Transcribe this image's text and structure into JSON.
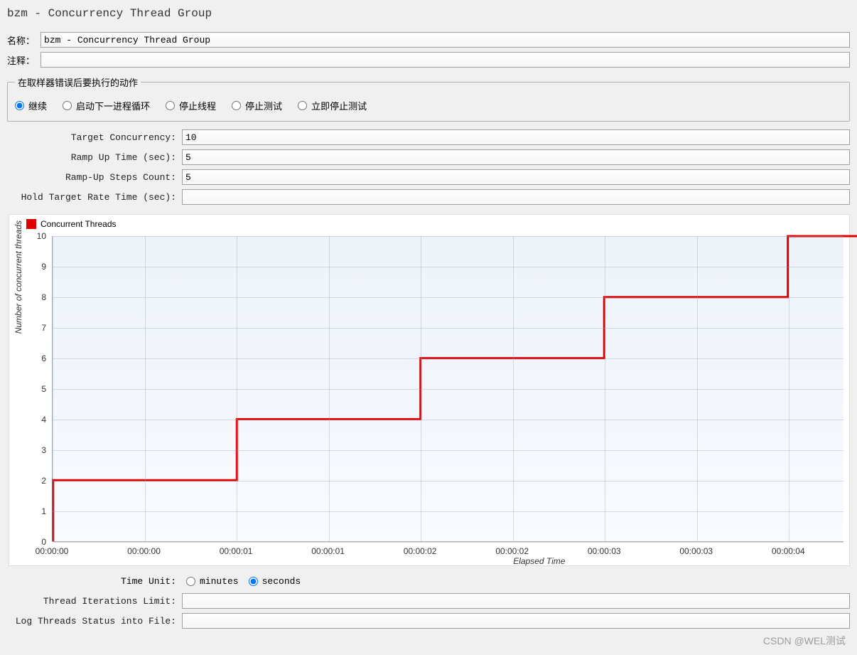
{
  "title": "bzm - Concurrency Thread Group",
  "labels": {
    "name": "名称：",
    "comment": "注释：",
    "error_action_group": "在取样器错误后要执行的动作"
  },
  "fields": {
    "name_value": "bzm - Concurrency Thread Group",
    "comment_value": "",
    "target_concurrency_label": "Target Concurrency:",
    "target_concurrency_value": "10",
    "ramp_up_time_label": "Ramp Up Time (sec):",
    "ramp_up_time_value": "5",
    "ramp_up_steps_label": "Ramp-Up Steps Count:",
    "ramp_up_steps_value": "5",
    "hold_target_label": "Hold Target Rate Time (sec):",
    "hold_target_value": "",
    "time_unit_label": "Time Unit:",
    "thread_iter_label": "Thread Iterations Limit:",
    "thread_iter_value": "",
    "log_file_label": "Log Threads Status into File:",
    "log_file_value": ""
  },
  "error_actions": {
    "continue": "继续",
    "next_loop": "启动下一进程循环",
    "stop_thread": "停止线程",
    "stop_test": "停止测试",
    "stop_test_now": "立即停止测试",
    "selected": "continue"
  },
  "time_unit": {
    "minutes": "minutes",
    "seconds": "seconds",
    "selected": "seconds"
  },
  "chart": {
    "legend": "Concurrent Threads",
    "ylabel": "Number of concurrent threads",
    "xlabel": "Elapsed Time",
    "color": "#e00000"
  },
  "chart_data": {
    "type": "line",
    "step": true,
    "x": [
      0,
      1,
      2,
      3,
      4,
      5
    ],
    "y": [
      2,
      4,
      6,
      8,
      10,
      10
    ],
    "ylim": [
      0,
      10
    ],
    "yticks": [
      0,
      1,
      2,
      3,
      4,
      5,
      6,
      7,
      8,
      9,
      10
    ],
    "xticks": [
      "00:00:00",
      "00:00:00",
      "00:00:01",
      "00:00:01",
      "00:00:02",
      "00:00:02",
      "00:00:03",
      "00:00:03",
      "00:00:04"
    ],
    "xlim": [
      0,
      4.3
    ],
    "title": "",
    "xlabel": "Elapsed Time",
    "ylabel": "Number of concurrent threads",
    "series": [
      {
        "name": "Concurrent Threads",
        "color": "#e00000"
      }
    ]
  },
  "watermark": "CSDN @WEL测试"
}
